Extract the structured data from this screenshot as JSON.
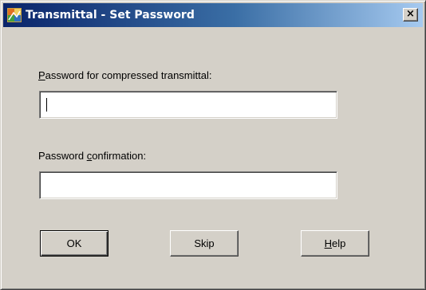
{
  "window": {
    "title": "Transmittal - Set Password",
    "close_glyph": "×"
  },
  "fields": {
    "password": {
      "label_accel": "P",
      "label_rest": "assword for compressed transmittal:",
      "value": ""
    },
    "confirm": {
      "label_pre": "Password ",
      "label_accel": "c",
      "label_rest": "onfirmation:",
      "value": ""
    }
  },
  "buttons": {
    "ok": "OK",
    "skip": "Skip",
    "help_accel": "H",
    "help_rest": "elp"
  },
  "icons": {
    "app": "transmittal-app-icon",
    "close": "close-icon"
  }
}
